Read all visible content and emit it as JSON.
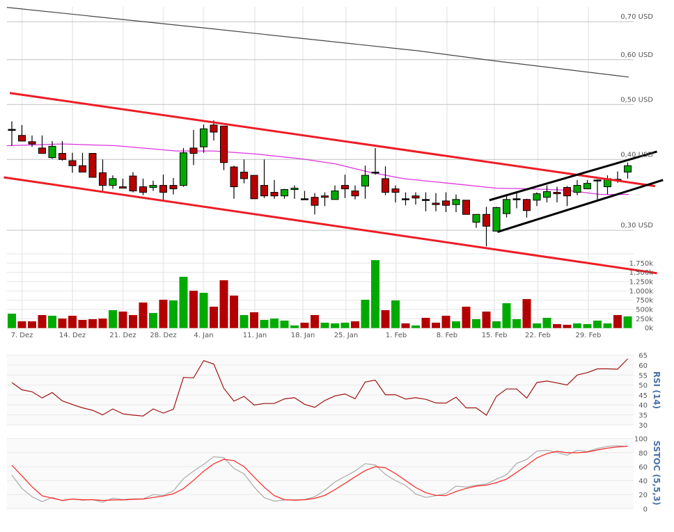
{
  "chart_data": [
    {
      "type": "candlestick",
      "panel": "price",
      "y_scale": "log",
      "ylim": [
        0.25,
        0.75
      ],
      "grid": true,
      "y_ticks": [
        {
          "value": 0.7,
          "label": "0,70 USD"
        },
        {
          "value": 0.6,
          "label": "0,60 USD"
        },
        {
          "value": 0.5,
          "label": "0,50 USD"
        },
        {
          "value": 0.4,
          "label": "0,40 USD"
        },
        {
          "value": 0.3,
          "label": "0,30 USD"
        }
      ],
      "x_ticks": [
        {
          "index": 1,
          "label": "7. Dez"
        },
        {
          "index": 6,
          "label": "14. Dez"
        },
        {
          "index": 11,
          "label": "21. Dez"
        },
        {
          "index": 15,
          "label": "28. Dez"
        },
        {
          "index": 19,
          "label": "4. Jan"
        },
        {
          "index": 24.07,
          "label": "11. Jan"
        },
        {
          "index": 28.83,
          "label": "18. Jan"
        },
        {
          "index": 33.1,
          "label": "25. Jan"
        },
        {
          "index": 38.07,
          "label": "1. Feb"
        },
        {
          "index": 43.1,
          "label": "8. Feb"
        },
        {
          "index": 47.8,
          "label": "15. Feb"
        },
        {
          "index": 52.1,
          "label": "22. Feb"
        },
        {
          "index": 57.1,
          "label": "29. Feb"
        }
      ],
      "ohlc_fields": [
        "open",
        "high",
        "low",
        "close"
      ],
      "ohlc": [
        [
          0.452,
          0.467,
          0.423,
          0.452
        ],
        [
          0.441,
          0.46,
          0.431,
          0.431
        ],
        [
          0.43,
          0.441,
          0.421,
          0.426
        ],
        [
          0.419,
          0.441,
          0.41,
          0.41
        ],
        [
          0.403,
          0.431,
          0.401,
          0.422
        ],
        [
          0.41,
          0.431,
          0.398,
          0.4
        ],
        [
          0.398,
          0.411,
          0.379,
          0.39
        ],
        [
          0.39,
          0.411,
          0.38,
          0.38
        ],
        [
          0.41,
          0.41,
          0.372,
          0.372
        ],
        [
          0.379,
          0.4,
          0.35,
          0.36
        ],
        [
          0.36,
          0.375,
          0.355,
          0.37
        ],
        [
          0.358,
          0.37,
          0.356,
          0.356
        ],
        [
          0.374,
          0.38,
          0.35,
          0.352
        ],
        [
          0.358,
          0.37,
          0.346,
          0.35
        ],
        [
          0.357,
          0.367,
          0.352,
          0.36
        ],
        [
          0.36,
          0.376,
          0.338,
          0.35
        ],
        [
          0.36,
          0.371,
          0.347,
          0.355
        ],
        [
          0.36,
          0.419,
          0.358,
          0.411
        ],
        [
          0.419,
          0.451,
          0.391,
          0.41
        ],
        [
          0.421,
          0.461,
          0.411,
          0.453
        ],
        [
          0.46,
          0.469,
          0.432,
          0.447
        ],
        [
          0.458,
          0.458,
          0.383,
          0.395
        ],
        [
          0.388,
          0.39,
          0.341,
          0.358
        ],
        [
          0.38,
          0.4,
          0.363,
          0.37
        ],
        [
          0.375,
          0.375,
          0.341,
          0.341
        ],
        [
          0.36,
          0.4,
          0.342,
          0.345
        ],
        [
          0.35,
          0.368,
          0.341,
          0.345
        ],
        [
          0.345,
          0.355,
          0.341,
          0.354
        ],
        [
          0.354,
          0.36,
          0.341,
          0.356
        ],
        [
          0.341,
          0.352,
          0.341,
          0.341
        ],
        [
          0.343,
          0.349,
          0.32,
          0.332
        ],
        [
          0.345,
          0.35,
          0.331,
          0.343
        ],
        [
          0.34,
          0.36,
          0.34,
          0.352
        ],
        [
          0.36,
          0.376,
          0.342,
          0.355
        ],
        [
          0.352,
          0.36,
          0.34,
          0.345
        ],
        [
          0.359,
          0.39,
          0.341,
          0.375
        ],
        [
          0.38,
          0.419,
          0.376,
          0.38
        ],
        [
          0.37,
          0.389,
          0.346,
          0.35
        ],
        [
          0.355,
          0.36,
          0.336,
          0.35
        ],
        [
          0.341,
          0.35,
          0.332,
          0.341
        ],
        [
          0.345,
          0.35,
          0.333,
          0.342
        ],
        [
          0.34,
          0.35,
          0.324,
          0.34
        ],
        [
          0.335,
          0.349,
          0.324,
          0.333
        ],
        [
          0.338,
          0.35,
          0.323,
          0.332
        ],
        [
          0.333,
          0.347,
          0.323,
          0.34
        ],
        [
          0.339,
          0.339,
          0.32,
          0.32
        ],
        [
          0.31,
          0.32,
          0.303,
          0.32
        ],
        [
          0.32,
          0.33,
          0.281,
          0.305
        ],
        [
          0.299,
          0.33,
          0.299,
          0.329
        ],
        [
          0.321,
          0.347,
          0.316,
          0.34
        ],
        [
          0.341,
          0.35,
          0.328,
          0.341
        ],
        [
          0.34,
          0.341,
          0.316,
          0.325
        ],
        [
          0.339,
          0.35,
          0.331,
          0.348
        ],
        [
          0.343,
          0.36,
          0.336,
          0.351
        ],
        [
          0.35,
          0.358,
          0.336,
          0.348
        ],
        [
          0.357,
          0.359,
          0.331,
          0.345
        ],
        [
          0.35,
          0.368,
          0.346,
          0.36
        ],
        [
          0.355,
          0.368,
          0.355,
          0.363
        ],
        [
          0.368,
          0.369,
          0.34,
          0.368
        ],
        [
          0.358,
          0.375,
          0.347,
          0.37
        ],
        [
          0.369,
          0.381,
          0.364,
          0.367
        ],
        [
          0.38,
          0.395,
          0.37,
          0.39
        ]
      ],
      "overlays": [
        {
          "kind": "moving-average",
          "color": "#444444",
          "points": [
            [
              -0.5,
              0.742
            ],
            [
              19.5,
              0.681
            ],
            [
              40.2,
              0.622
            ],
            [
              47.8,
              0.597
            ],
            [
              61.1,
              0.559
            ]
          ]
        },
        {
          "kind": "moving-average",
          "color": "#dd33dd",
          "points": [
            [
              -0.5,
              0.423
            ],
            [
              5,
              0.426
            ],
            [
              10.3,
              0.423
            ],
            [
              16.3,
              0.414
            ],
            [
              20,
              0.414
            ],
            [
              24.1,
              0.409
            ],
            [
              28.7,
              0.401
            ],
            [
              32,
              0.393
            ],
            [
              35.4,
              0.38
            ],
            [
              38.8,
              0.37
            ],
            [
              43.4,
              0.363
            ],
            [
              48,
              0.356
            ],
            [
              51.4,
              0.355
            ],
            [
              54.9,
              0.353
            ],
            [
              58.3,
              0.347
            ],
            [
              61.1,
              0.347
            ]
          ]
        }
      ],
      "trendlines": [
        {
          "color": "#ee1c25",
          "from": [
            -0.2,
            0.524
          ],
          "to": [
            63.7,
            0.359
          ]
        },
        {
          "color": "#ee1c25",
          "from": [
            -0.8,
            0.372
          ],
          "to": [
            63.9,
            0.252
          ]
        },
        {
          "color": "#000000",
          "from": [
            47.3,
            0.339
          ],
          "to": [
            63.9,
            0.413
          ]
        },
        {
          "color": "#000000",
          "from": [
            48.1,
            0.298
          ],
          "to": [
            64.5,
            0.368
          ]
        }
      ],
      "colors": {
        "up": "#00aa00",
        "down": "#b80000"
      }
    },
    {
      "type": "bar",
      "panel": "volume",
      "ylim": [
        0,
        1750
      ],
      "y_ticks": [
        {
          "value": 1750,
          "label": "1.750k"
        },
        {
          "value": 1500,
          "label": "1.500k"
        },
        {
          "value": 1250,
          "label": "1.250k"
        },
        {
          "value": 1000,
          "label": "1.000k"
        },
        {
          "value": 750,
          "label": "750k"
        },
        {
          "value": 500,
          "label": "500k"
        },
        {
          "value": 250,
          "label": "250k"
        },
        {
          "value": 0,
          "label": "0k"
        }
      ],
      "values_k": [
        388,
        181,
        181,
        350,
        331,
        256,
        331,
        219,
        238,
        256,
        481,
        444,
        350,
        688,
        406,
        763,
        744,
        1381,
        1006,
        950,
        575,
        1288,
        875,
        350,
        425,
        219,
        256,
        200,
        69,
        144,
        350,
        144,
        125,
        144,
        181,
        763,
        1831,
        481,
        744,
        125,
        69,
        275,
        144,
        331,
        181,
        575,
        238,
        444,
        181,
        669,
        238,
        781,
        125,
        275,
        106,
        88,
        125,
        106,
        200,
        125,
        350,
        313
      ],
      "direction": [
        "up",
        "down",
        "down",
        "down",
        "up",
        "down",
        "down",
        "down",
        "down",
        "down",
        "up",
        "down",
        "down",
        "down",
        "up",
        "down",
        "up",
        "up",
        "down",
        "up",
        "down",
        "down",
        "down",
        "up",
        "down",
        "up",
        "up",
        "up",
        "up",
        "down",
        "down",
        "up",
        "up",
        "up",
        "down",
        "up",
        "up",
        "down",
        "up",
        "down",
        "up",
        "down",
        "down",
        "down",
        "up",
        "down",
        "up",
        "down",
        "up",
        "up",
        "up",
        "down",
        "up",
        "up",
        "down",
        "down",
        "up",
        "up",
        "up",
        "up",
        "down",
        "up"
      ],
      "colors": {
        "up": "#00aa00",
        "down": "#b30000"
      }
    },
    {
      "type": "line",
      "panel": "rsi",
      "title": "RSI (14)",
      "ylim": [
        30,
        65
      ],
      "y_ticks": [
        65,
        60,
        55,
        50,
        45,
        40,
        35,
        30
      ],
      "series": [
        {
          "color": "#a01010",
          "values": [
            51.2,
            47.6,
            46.6,
            43.5,
            46.2,
            42.0,
            40.2,
            38.5,
            37.3,
            35.0,
            38.0,
            35.5,
            34.9,
            34.4,
            38.0,
            35.9,
            37.8,
            53.8,
            53.6,
            62.2,
            60.5,
            48.3,
            41.9,
            44.3,
            39.9,
            40.7,
            40.7,
            43.0,
            43.6,
            40.3,
            38.8,
            42.2,
            44.5,
            45.5,
            43.1,
            51.5,
            52.4,
            45.1,
            45.1,
            42.9,
            43.6,
            42.8,
            41.0,
            40.9,
            43.9,
            38.5,
            38.5,
            34.8,
            44.3,
            48.0,
            48.0,
            43.4,
            51.2,
            52.0,
            51.0,
            50.0,
            55.0,
            56.2,
            58.1,
            58.1,
            57.9,
            63.1
          ]
        }
      ]
    },
    {
      "type": "line",
      "panel": "sstoc",
      "title": "SSTOC (5,5,3)",
      "ylim": [
        0,
        100
      ],
      "y_ticks": [
        100,
        80,
        60,
        40,
        20,
        0
      ],
      "series": [
        {
          "color": "#aaaaaa",
          "values": [
            47.7,
            28.8,
            16.9,
            9.9,
            15.9,
            11.3,
            13.6,
            11.9,
            12.9,
            8.9,
            14.9,
            12.9,
            13.9,
            13.9,
            19.9,
            18.9,
            25.2,
            42.7,
            53.6,
            63.2,
            74.2,
            72.8,
            57.3,
            49.7,
            30.8,
            15.6,
            10.6,
            12.3,
            12.6,
            12.9,
            16.9,
            26.2,
            38.0,
            46.0,
            53.6,
            64.2,
            62.3,
            48.7,
            40.1,
            33.1,
            20.9,
            15.9,
            18.5,
            21.5,
            32.1,
            30.8,
            33.4,
            35.1,
            42.1,
            48.3,
            64.6,
            70.2,
            82.1,
            83.4,
            80.1,
            76.2,
            83.4,
            81.5,
            85.8,
            89.1,
            89.7,
            89.1
          ]
        },
        {
          "color": "#ff2020",
          "values": [
            61.9,
            46.7,
            31.1,
            18.2,
            14.9,
            11.6,
            13.6,
            12.6,
            12.6,
            11.6,
            12.3,
            12.3,
            13.2,
            13.6,
            15.9,
            17.9,
            21.2,
            28.5,
            40.4,
            53.3,
            63.9,
            70.5,
            68.5,
            59.9,
            45.0,
            30.5,
            18.5,
            12.6,
            11.9,
            12.6,
            14.6,
            18.9,
            27.0,
            36.1,
            45.4,
            54.3,
            59.9,
            58.3,
            50.0,
            40.1,
            30.1,
            22.8,
            18.9,
            18.5,
            24.5,
            28.8,
            32.1,
            33.4,
            37.1,
            42.1,
            51.7,
            61.6,
            72.5,
            78.5,
            81.8,
            79.8,
            79.8,
            80.8,
            83.8,
            86.4,
            88.1,
            89.1
          ]
        }
      ]
    }
  ]
}
